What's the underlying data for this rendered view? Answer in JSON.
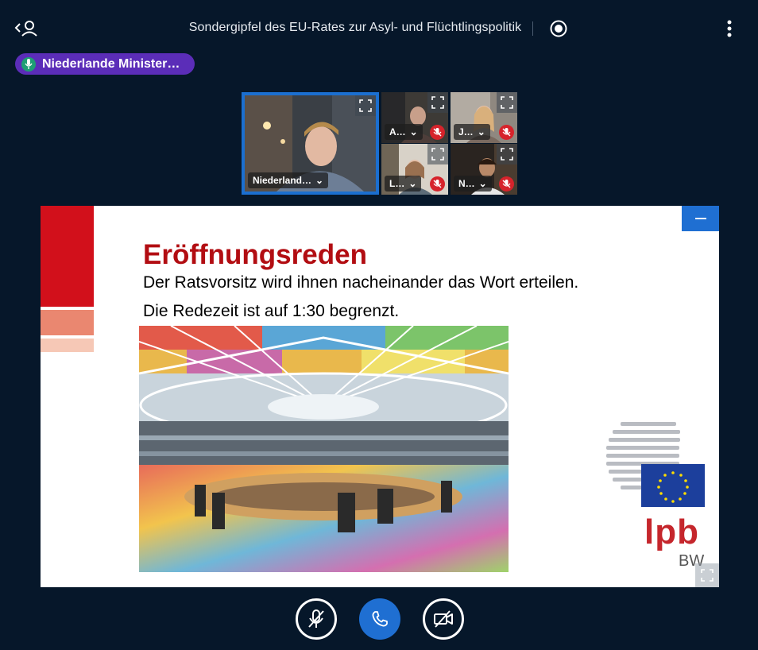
{
  "header": {
    "title": "Sondergipfel des EU-Rates zur Asyl- und Flüchtlingspolitik",
    "user_toggle_icon": "user-list-icon",
    "record_icon": "record-icon",
    "more_icon": "more-vertical-icon"
  },
  "talking_indicator": {
    "label": "Niederlande Minister…",
    "icon": "microphone-icon"
  },
  "video_tiles": [
    {
      "name": "Niederland…",
      "muted": false
    },
    {
      "name": "A…",
      "muted": true
    },
    {
      "name": "J…",
      "muted": true
    },
    {
      "name": "L…",
      "muted": true
    },
    {
      "name": "N…",
      "muted": true
    }
  ],
  "presentation": {
    "title": "Eröffnungsreden",
    "line1": "Der Ratsvorsitz wird ihnen nacheinander das Wort erteilen.",
    "line2": "Die Redezeit ist auf 1:30 begrenzt.",
    "logo_text": "lpb",
    "logo_subtext": "BW",
    "colors": {
      "title": "#b20d12",
      "logo": "#c5262c",
      "bar_dark": "#d2101b",
      "bar_mid": "#ea8770",
      "bar_light": "#f6c8b6"
    }
  },
  "controls": {
    "mute_icon": "microphone-muted-icon",
    "hangup_icon": "phone-icon",
    "video_icon": "camera-off-icon"
  },
  "colors": {
    "background": "#06172a",
    "accent": "#1f6fd2",
    "talking": "#5b2db8",
    "muted": "#d6232b"
  }
}
